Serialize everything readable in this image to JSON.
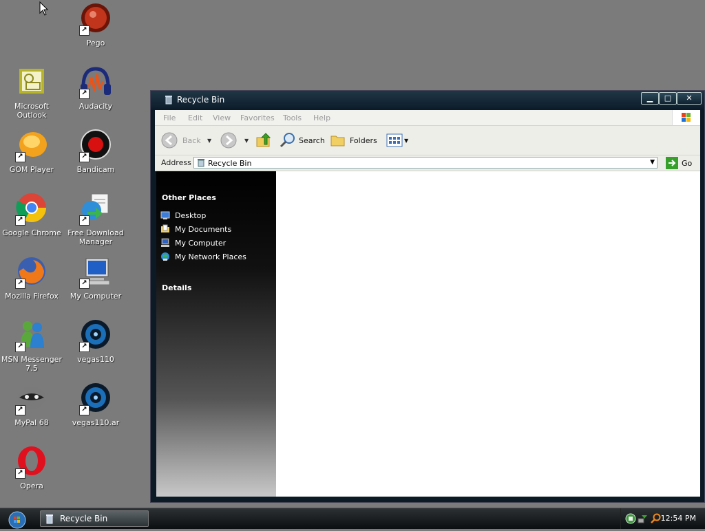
{
  "desktop": {
    "icons": [
      {
        "name": "",
        "label": "Pego"
      },
      {
        "name": "",
        "label": "Microsoft Outlook"
      },
      {
        "name": "",
        "label": "Audacity"
      },
      {
        "name": "",
        "label": "GOM Player"
      },
      {
        "name": "",
        "label": "Bandicam"
      },
      {
        "name": "",
        "label": "Google Chrome"
      },
      {
        "name": "",
        "label": "Free Download Manager"
      },
      {
        "name": "",
        "label": "Mozilla Firefox"
      },
      {
        "name": "",
        "label": "My Computer"
      },
      {
        "name": "",
        "label": "MSN Messenger 7.5"
      },
      {
        "name": "",
        "label": "vegas110"
      },
      {
        "name": "",
        "label": "MyPal 68"
      },
      {
        "name": "",
        "label": "vegas110.ar"
      },
      {
        "name": "",
        "label": "Opera"
      }
    ]
  },
  "window": {
    "title": "Recycle Bin",
    "menu": [
      "File",
      "Edit",
      "View",
      "Favorites",
      "Tools",
      "Help"
    ],
    "toolbar": {
      "back": "Back",
      "search": "Search",
      "folders": "Folders"
    },
    "address": {
      "label": "Address",
      "value": "Recycle Bin",
      "go": "Go"
    },
    "taskpane": {
      "other_places_title": "Other Places",
      "places": [
        "Desktop",
        "My Documents",
        "My Computer",
        "My Network Places"
      ],
      "details_title": "Details"
    }
  },
  "taskbar": {
    "button_label": "Recycle Bin",
    "clock": "12:54 PM"
  }
}
